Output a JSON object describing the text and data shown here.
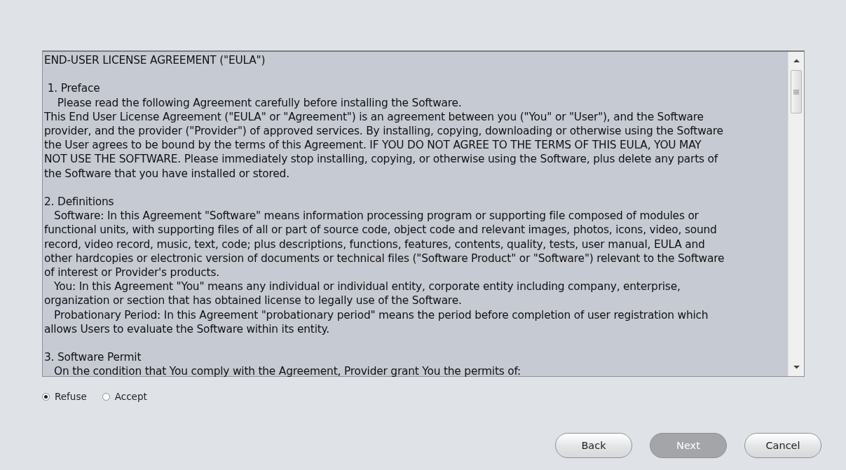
{
  "agreement": {
    "sections": [
      [
        "END-USER LICENSE AGREEMENT (\"EULA\")"
      ],
      [
        " 1. Preface",
        "    Please read the following Agreement carefully before installing the Software.",
        "This End User License Agreement (\"EULA\" or \"Agreement\") is an agreement between you (\"You\" or \"User\"), and the Software",
        "provider, and the provider (\"Provider\") of approved services. By installing, copying, downloading or otherwise using the Software",
        "the User agrees to be bound by the terms of this Agreement. IF YOU DO NOT AGREE TO THE TERMS OF THIS EULA, YOU MAY",
        "NOT USE THE SOFTWARE. Please immediately stop installing, copying, or otherwise using the Software, plus delete any parts of",
        "the Software that you have installed or stored."
      ],
      [
        "2. Definitions",
        "   Software: In this Agreement \"Software\" means information processing program or supporting file composed of modules or",
        "functional units, with supporting files of all or part of source code, object code and relevant images, photos, icons, video, sound",
        "record, video record, music, text, code; plus descriptions, functions, features, contents, quality, tests, user manual, EULA and",
        "other hardcopies or electronic version of documents or technical files (\"Software Product\" or \"Software\") relevant to the Software",
        "of interest or Provider's products.",
        "   You: In this Agreement \"You\" means any individual or individual entity, corporate entity including company, enterprise,",
        "organization or section that has obtained license to legally use of the Software.",
        "   Probationary Period: In this Agreement \"probationary period\" means the period before completion of user registration which",
        "allows Users to evaluate the Software within its entity."
      ],
      [
        "3. Software Permit",
        "   On the condition that You comply with the Agreement, Provider grant You the permits of:"
      ]
    ]
  },
  "choices": [
    {
      "label": "Refuse",
      "selected": true
    },
    {
      "label": "Accept",
      "selected": false
    }
  ],
  "buttons": [
    {
      "label": "Back",
      "disabled": false
    },
    {
      "label": "Next",
      "disabled": true
    },
    {
      "label": "Cancel",
      "disabled": false
    }
  ]
}
